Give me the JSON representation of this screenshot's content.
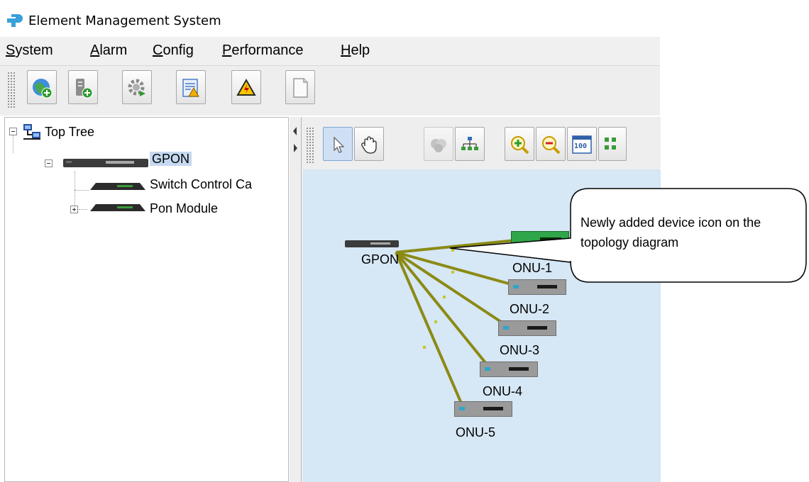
{
  "window": {
    "title": "Element Management System"
  },
  "menu": {
    "items": [
      {
        "mnemonic": "S",
        "rest": "ystem"
      },
      {
        "mnemonic": "A",
        "rest": "larm"
      },
      {
        "mnemonic": "C",
        "rest": "onfig"
      },
      {
        "mnemonic": "P",
        "rest": "erformance"
      },
      {
        "mnemonic": "H",
        "rest": "elp"
      }
    ]
  },
  "toolbar": {
    "buttons": [
      "globe-add-icon",
      "server-add-icon",
      "gear-icon",
      "alarm-report-icon",
      "warning-icon",
      "document-icon"
    ]
  },
  "tree": {
    "root": "Top Tree",
    "device": "GPON",
    "children": [
      "Switch Control Ca",
      "Pon Module"
    ]
  },
  "topology": {
    "tools": [
      "select-arrow-icon",
      "hand-pan-icon",
      "device-group-icon",
      "hierarchy-layout-icon",
      "zoom-in-icon",
      "zoom-out-icon",
      "zoom-100-icon",
      "grid-layout-icon"
    ],
    "zoom_label": "100",
    "center_node": "GPON",
    "onu_nodes": [
      "ONU-1",
      "ONU-2",
      "ONU-3",
      "ONU-4",
      "ONU-5"
    ],
    "link_color": "#8b8a14",
    "canvas_color": "#d6e7f5"
  },
  "callout": {
    "text": "Newly added device icon on the topology diagram"
  }
}
